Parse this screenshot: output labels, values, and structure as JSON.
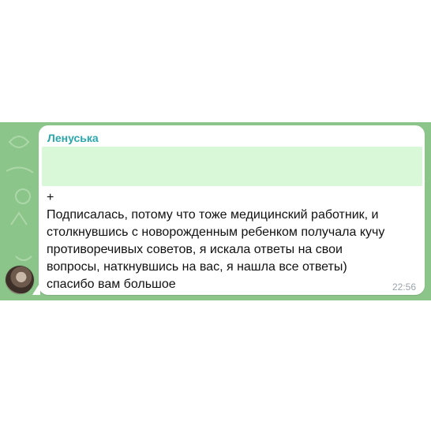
{
  "message": {
    "sender_name": "Ленуська",
    "text": "+\nПодписалась, потому что тоже медицинский работник, и\nстолкнувшись с новорожденным ребенком получала кучу\nпротиворечивых советов, я искала ответы на свои\nвопросы, наткнувшись на вас, я нашла все ответы)\nспасибо вам большое",
    "time": "22:56"
  },
  "colors": {
    "wallpaper": "#8cc58a",
    "bubble": "#ffffff",
    "sender_name": "#2aa7ad",
    "quote_background": "#d8f8d8",
    "timestamp": "#9aa4ab"
  },
  "icons": {
    "avatar": "user-avatar"
  }
}
